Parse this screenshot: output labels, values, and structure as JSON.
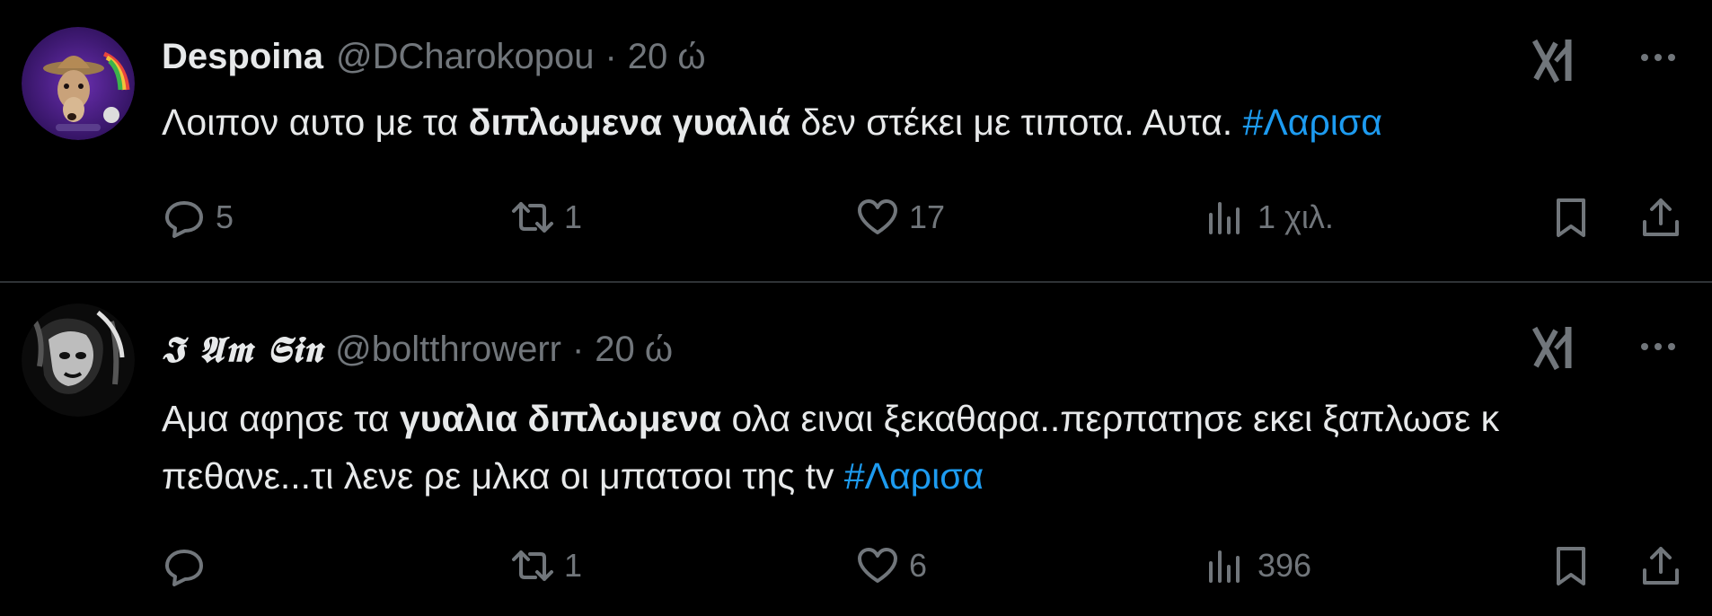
{
  "tweets": [
    {
      "author_name": "Despoina",
      "handle": "@DCharokopou",
      "separator": "·",
      "time": "20 ώ",
      "text_before": "Λοιπον αυτο με τα ",
      "text_bold": "διπλωμενα γυαλιά",
      "text_after": " δεν στέκει με τιποτα. Αυτα. ",
      "hashtag": "#Λαρισα",
      "replies": "5",
      "reposts": "1",
      "likes": "17",
      "views": "1 χιλ."
    },
    {
      "author_name": "𝕴 𝕬𝖒 𝕾𝖎𝖓",
      "handle": "@boltthrowerr",
      "separator": "·",
      "time": "20 ώ",
      "text_before": "Αμα αφησε τα ",
      "text_bold": "γυαλια διπλωμενα",
      "text_after": " ολα ειναι ξεκαθαρα..περπατησε εκει ξαπλωσε κ πεθανε...τι λενε ρε μλκα οι μπατσοι της tv ",
      "hashtag": "#Λαρισα",
      "replies": "",
      "reposts": "1",
      "likes": "6",
      "views": "396"
    }
  ],
  "colors": {
    "background": "#000000",
    "text": "#e7e9ea",
    "muted": "#71767b",
    "link": "#1d9bf0",
    "divider": "#2f3336"
  },
  "icons": [
    "reply-icon",
    "repost-icon",
    "like-icon",
    "views-icon",
    "bookmark-icon",
    "share-icon",
    "grok-icon",
    "more-icon"
  ]
}
